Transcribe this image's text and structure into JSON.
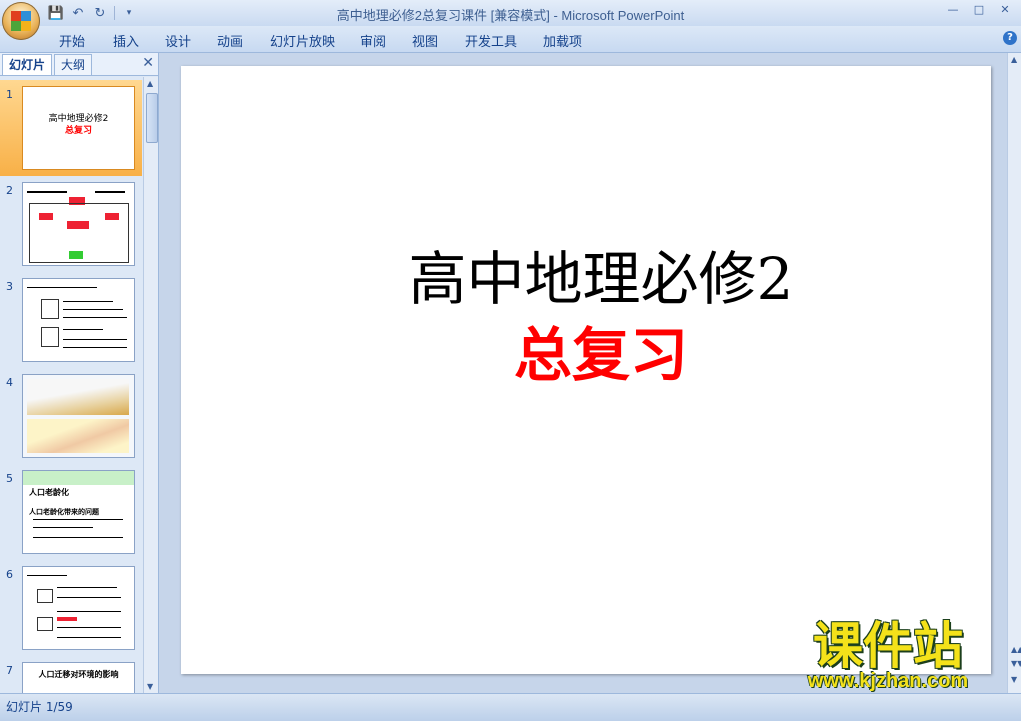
{
  "window": {
    "title": "高中地理必修2总复习课件 [兼容模式] - Microsoft PowerPoint"
  },
  "quick_access": {
    "icons": [
      "save-icon",
      "undo-icon",
      "redo-icon",
      "customize-icon"
    ]
  },
  "ribbon": {
    "tabs": [
      {
        "label": "开始"
      },
      {
        "label": "插入"
      },
      {
        "label": "设计"
      },
      {
        "label": "动画"
      },
      {
        "label": "幻灯片放映"
      },
      {
        "label": "审阅"
      },
      {
        "label": "视图"
      },
      {
        "label": "开发工具"
      },
      {
        "label": "加载项"
      }
    ]
  },
  "left_pane": {
    "tabs": [
      {
        "label": "幻灯片",
        "active": true
      },
      {
        "label": "大纲",
        "active": false
      }
    ],
    "thumbnails": [
      {
        "num": "1",
        "selected": true,
        "title": "高中地理必修2",
        "subtitle": "总复习"
      },
      {
        "num": "2",
        "selected": false
      },
      {
        "num": "3",
        "selected": false
      },
      {
        "num": "4",
        "selected": false
      },
      {
        "num": "5",
        "selected": false,
        "heading": "人口老龄化",
        "heading2": "人口老龄化带来的问题"
      },
      {
        "num": "6",
        "selected": false
      },
      {
        "num": "7",
        "selected": false,
        "heading": "人口迁移对环境的影响"
      }
    ]
  },
  "slide": {
    "title": "高中地理必修2",
    "subtitle": "总复习"
  },
  "status": {
    "text": "幻灯片 1/59"
  },
  "watermark": {
    "main": "课件站",
    "url": "www.kjzhan.com"
  },
  "colors": {
    "accent": "#15428b",
    "selected": "#f8b047",
    "subtitle": "#ff0000",
    "watermark": "#f4e21a"
  }
}
